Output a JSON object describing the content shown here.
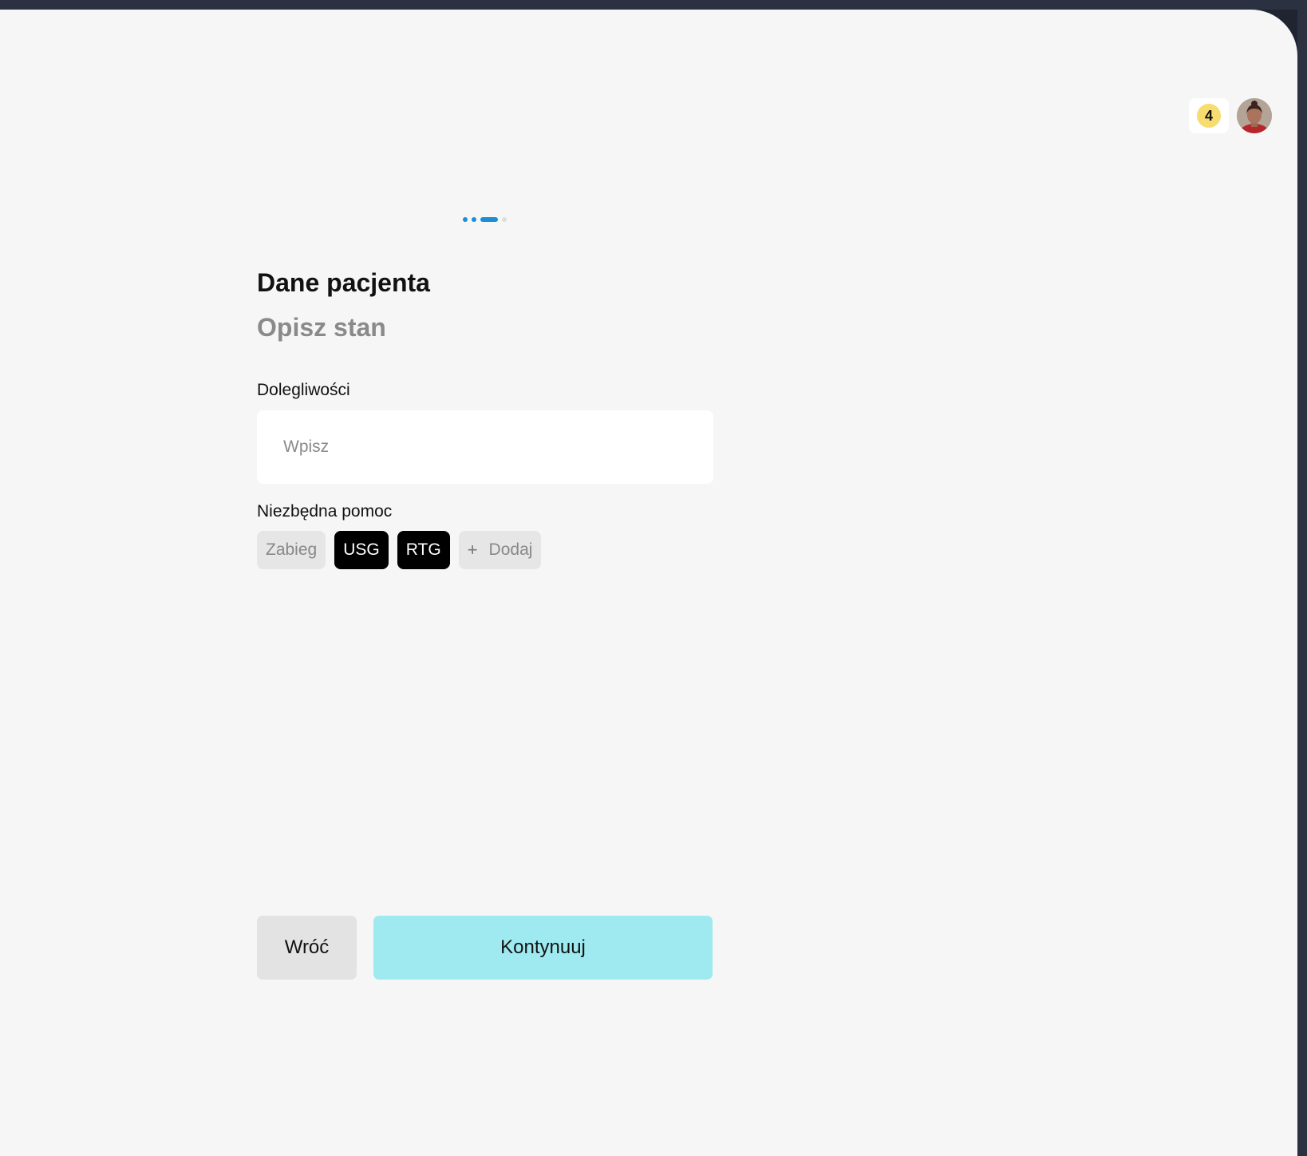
{
  "header": {
    "notification_count": "4",
    "notification_color": "#f7dc6f"
  },
  "progress": {
    "current_step": 3,
    "total_steps": 4,
    "accent": "#1a8fd8"
  },
  "form": {
    "title": "Dane pacjenta",
    "subtitle": "Opisz stan",
    "complaints_label": "Dolegliwości",
    "complaints_placeholder": "Wpisz",
    "complaints_value": "",
    "help_label": "Niezbędna pomoc",
    "chips": [
      {
        "label": "Zabieg",
        "selected": false
      },
      {
        "label": "USG",
        "selected": true
      },
      {
        "label": "RTG",
        "selected": true
      }
    ],
    "add_chip_label": "Dodaj",
    "add_chip_icon": "plus-icon"
  },
  "actions": {
    "back_label": "Wróć",
    "continue_label": "Kontynuuj",
    "continue_color": "#9eeaf0"
  }
}
